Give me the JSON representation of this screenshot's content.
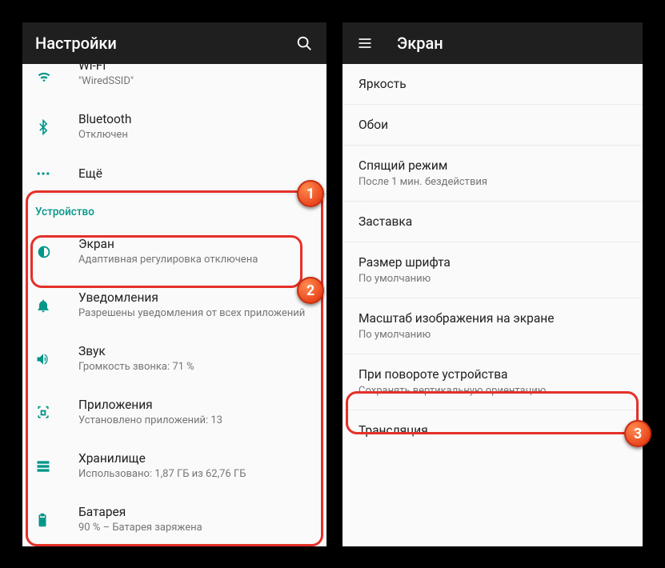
{
  "left": {
    "title": "Настройки",
    "wifi": {
      "label": "Wi-Fi",
      "sub": "\"WiredSSID\""
    },
    "bluetooth": {
      "label": "Bluetooth",
      "sub": "Отключен"
    },
    "more": {
      "label": "Ещё"
    },
    "section_device": "Устройство",
    "display": {
      "label": "Экран",
      "sub": "Адаптивная регулировка отключена"
    },
    "notifications": {
      "label": "Уведомления",
      "sub": "Разрешены уведомления от всех приложений"
    },
    "sound": {
      "label": "Звук",
      "sub": "Громкость звонка: 71 %"
    },
    "apps": {
      "label": "Приложения",
      "sub": "Установлено приложений: 13"
    },
    "storage": {
      "label": "Хранилище",
      "sub": "Использовано: 1,87 ГБ из 62,76 ГБ"
    },
    "battery": {
      "label": "Батарея",
      "sub": "90 % – Батарея заряжена"
    }
  },
  "right": {
    "title": "Экран",
    "brightness": {
      "label": "Яркость"
    },
    "wallpaper": {
      "label": "Обои"
    },
    "sleep": {
      "label": "Спящий режим",
      "sub": "После 1 мин. бездействия"
    },
    "screensaver": {
      "label": "Заставка"
    },
    "fontsize": {
      "label": "Размер шрифта",
      "sub": "По умолчанию"
    },
    "displaysize": {
      "label": "Масштаб изображения на экране",
      "sub": "По умолчанию"
    },
    "rotation": {
      "label": "При повороте устройства",
      "sub": "Сохранять вертикальную ориентацию"
    },
    "cast": {
      "label": "Трансляция"
    }
  },
  "badges": {
    "b1": "1",
    "b2": "2",
    "b3": "3"
  }
}
